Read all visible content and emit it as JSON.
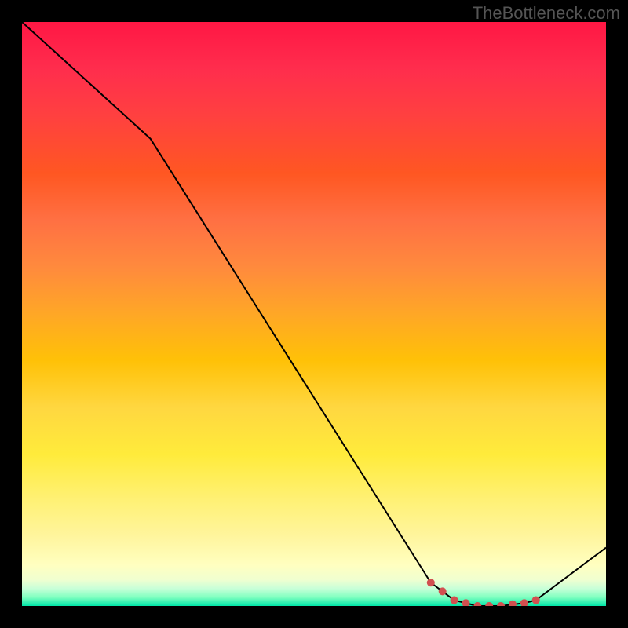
{
  "watermark": "TheBottleneck.com",
  "chart_data": {
    "type": "line",
    "title": "",
    "xlabel": "",
    "ylabel": "",
    "x": [
      0,
      22,
      70,
      74,
      78,
      82,
      86,
      88,
      100
    ],
    "values": [
      100,
      80,
      4,
      1,
      0,
      0,
      0.5,
      1,
      10
    ],
    "markers": {
      "x": [
        70,
        72,
        74,
        76,
        78,
        80,
        82,
        84,
        86,
        88
      ],
      "values": [
        4,
        2.5,
        1,
        0.5,
        0,
        0,
        0,
        0.3,
        0.5,
        1
      ]
    },
    "xlim": [
      0,
      100
    ],
    "ylim": [
      0,
      100
    ]
  },
  "colors": {
    "background": "#000000",
    "line": "#000000",
    "marker": "#d15050"
  }
}
